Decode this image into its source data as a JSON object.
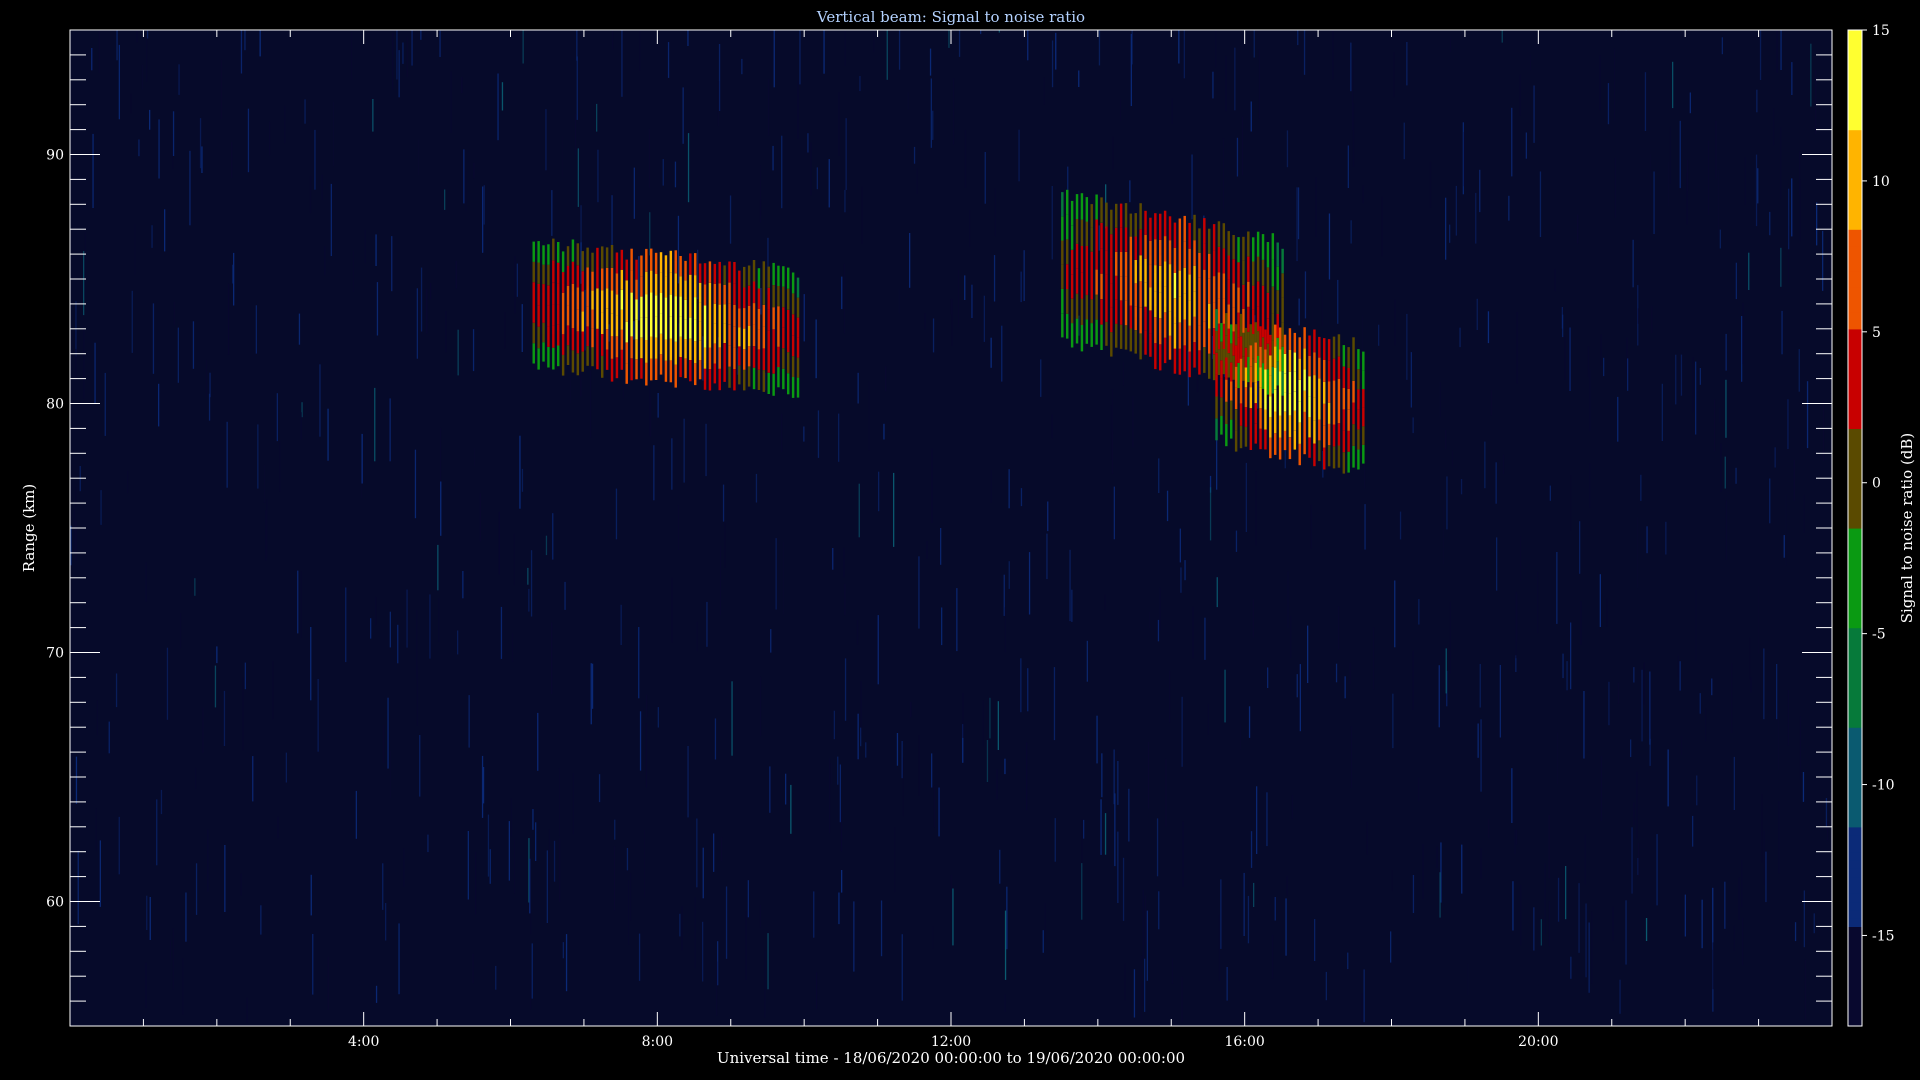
{
  "chart_data": {
    "type": "heatmap",
    "title": "Vertical beam: Signal to noise ratio",
    "xlabel": "Universal time - 18/06/2020 00:00:00 to 19/06/2020 00:00:00",
    "ylabel": "Range (km)",
    "x_unit": "hours UT",
    "xlim": [
      0,
      24
    ],
    "ylim": [
      55,
      95
    ],
    "x_ticks": [
      {
        "value": 4,
        "label": "4:00"
      },
      {
        "value": 8,
        "label": "8:00"
      },
      {
        "value": 12,
        "label": "12:00"
      },
      {
        "value": 16,
        "label": "16:00"
      },
      {
        "value": 20,
        "label": "20:00"
      }
    ],
    "y_ticks": [
      {
        "value": 60,
        "label": "60"
      },
      {
        "value": 70,
        "label": "70"
      },
      {
        "value": 80,
        "label": "80"
      },
      {
        "value": 90,
        "label": "90"
      }
    ],
    "colorbar": {
      "label": "Signal to noise ratio (dB)",
      "range": [
        -18,
        15
      ],
      "ticks": [
        {
          "value": 15,
          "label": "15"
        },
        {
          "value": 10,
          "label": "10"
        },
        {
          "value": 5,
          "label": "5"
        },
        {
          "value": 0,
          "label": "0"
        },
        {
          "value": -5,
          "label": "-5"
        },
        {
          "value": -10,
          "label": "-10"
        },
        {
          "value": -15,
          "label": "-15"
        }
      ],
      "colors": [
        "#08082e",
        "#0b2a78",
        "#0a5a70",
        "#067a3a",
        "#0a9a12",
        "#5a4a00",
        "#c80000",
        "#ee5500",
        "#ffb400",
        "#ffff30"
      ]
    },
    "background_snr": -17,
    "echo_regions": [
      {
        "t_start": 6.3,
        "t_end": 9.9,
        "range_low": 81.5,
        "range_high": 86.5,
        "peak_snr": 14
      },
      {
        "t_start": 13.5,
        "t_end": 16.5,
        "range_low": 82.5,
        "range_high": 88.5,
        "peak_snr": 10
      },
      {
        "t_start": 15.6,
        "t_end": 17.6,
        "range_low": 78.5,
        "range_high": 83.5,
        "peak_snr": 14
      }
    ]
  },
  "colors": {
    "background": "#000000",
    "plot_background": "#060a2a",
    "axes": "#ffffff",
    "title": "#b4d2ff",
    "text": "#ffffff"
  }
}
